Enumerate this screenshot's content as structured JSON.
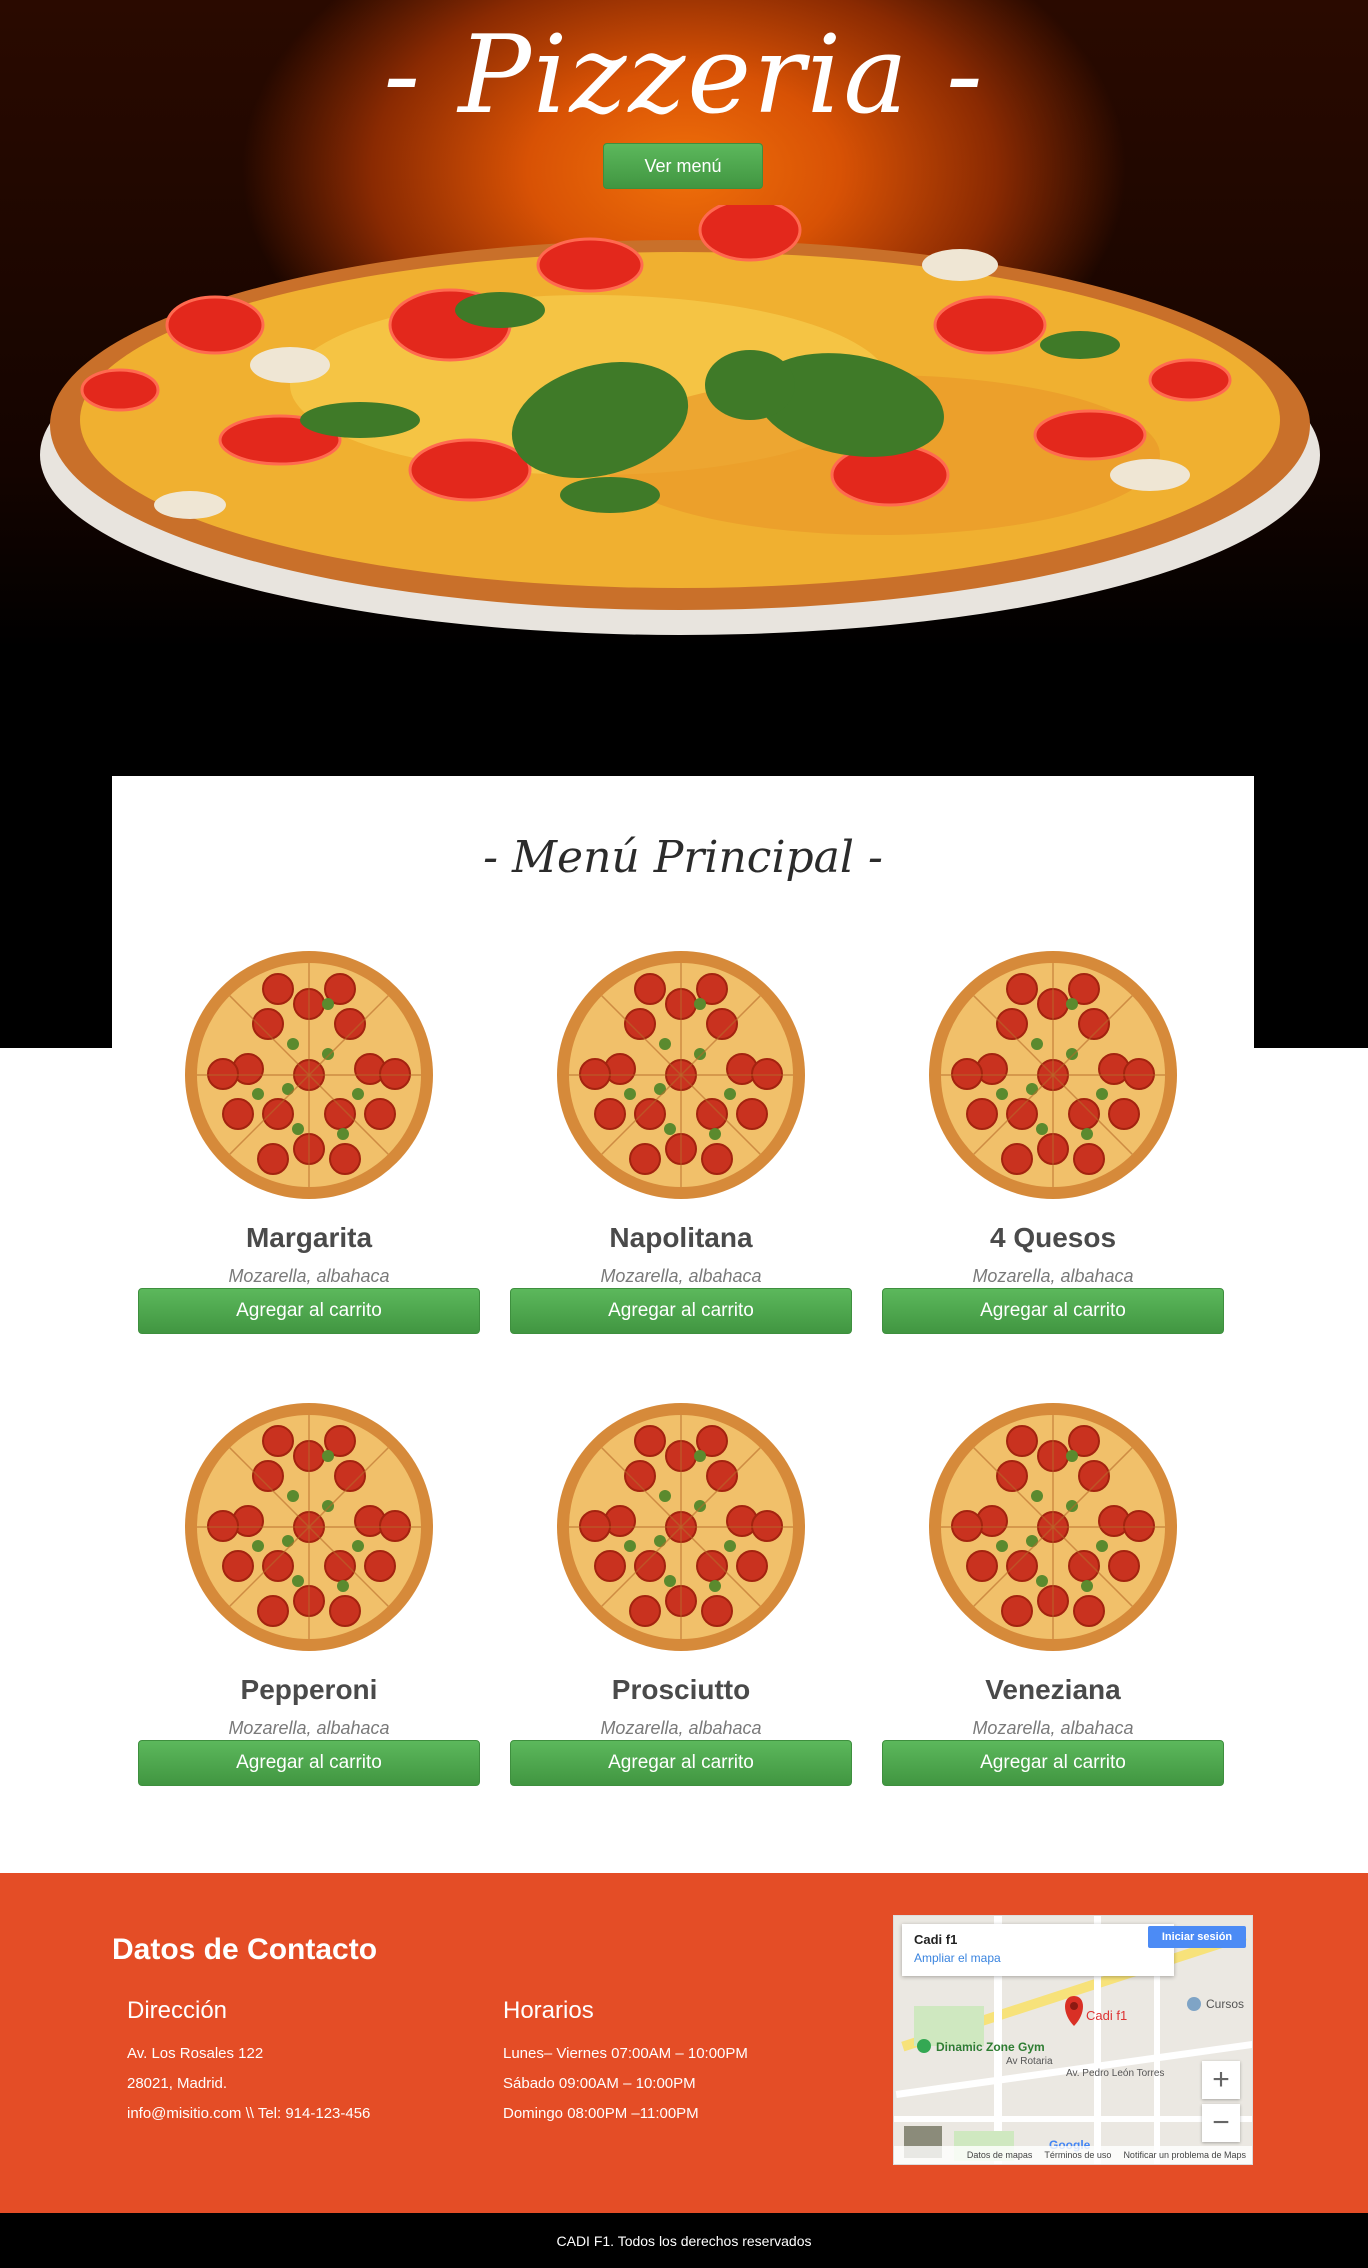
{
  "hero": {
    "title": "- Pizzeria -",
    "button": "Ver menú"
  },
  "menu": {
    "title": "- Menú Principal -",
    "items": [
      {
        "name": "Margarita",
        "desc": "Mozarella, albahaca",
        "button": "Agregar al carrito"
      },
      {
        "name": "Napolitana",
        "desc": "Mozarella, albahaca",
        "button": "Agregar al carrito"
      },
      {
        "name": "4 Quesos",
        "desc": "Mozarella, albahaca",
        "button": "Agregar al carrito"
      },
      {
        "name": "Pepperoni",
        "desc": "Mozarella, albahaca",
        "button": "Agregar al carrito"
      },
      {
        "name": "Prosciutto",
        "desc": "Mozarella, albahaca",
        "button": "Agregar al carrito"
      },
      {
        "name": "Veneziana",
        "desc": "Mozarella, albahaca",
        "button": "Agregar al carrito"
      }
    ]
  },
  "contact": {
    "title": "Datos de Contacto",
    "address": {
      "heading": "Dirección",
      "line1": "Av. Los Rosales 122",
      "line2": "28021, Madrid.",
      "line3": "info@misitio.com \\\\ Tel: 914-123-456"
    },
    "hours": {
      "heading": "Horarios",
      "line1": "Lunes– Viernes 07:00AM – 10:00PM",
      "line2": "Sábado 09:00AM – 10:00PM",
      "line3": "Domingo 08:00PM –11:00PM"
    },
    "map": {
      "place": "Cadi f1",
      "enlarge": "Ampliar el mapa",
      "login": "Iniciar sesión",
      "pin_label": "Cadi f1",
      "poi1": "Dinamic Zone Gym",
      "poi2": "Cursos",
      "street": "Av. Pedro León Torres",
      "street2": "Av Rotaria",
      "brand": "Google",
      "foot1": "Datos de mapas",
      "foot2": "Términos de uso",
      "foot3": "Notificar un problema de Maps",
      "zoom_in": "+",
      "zoom_out": "−"
    }
  },
  "footer": {
    "text": "CADI F1. Todos los derechos reservados"
  }
}
